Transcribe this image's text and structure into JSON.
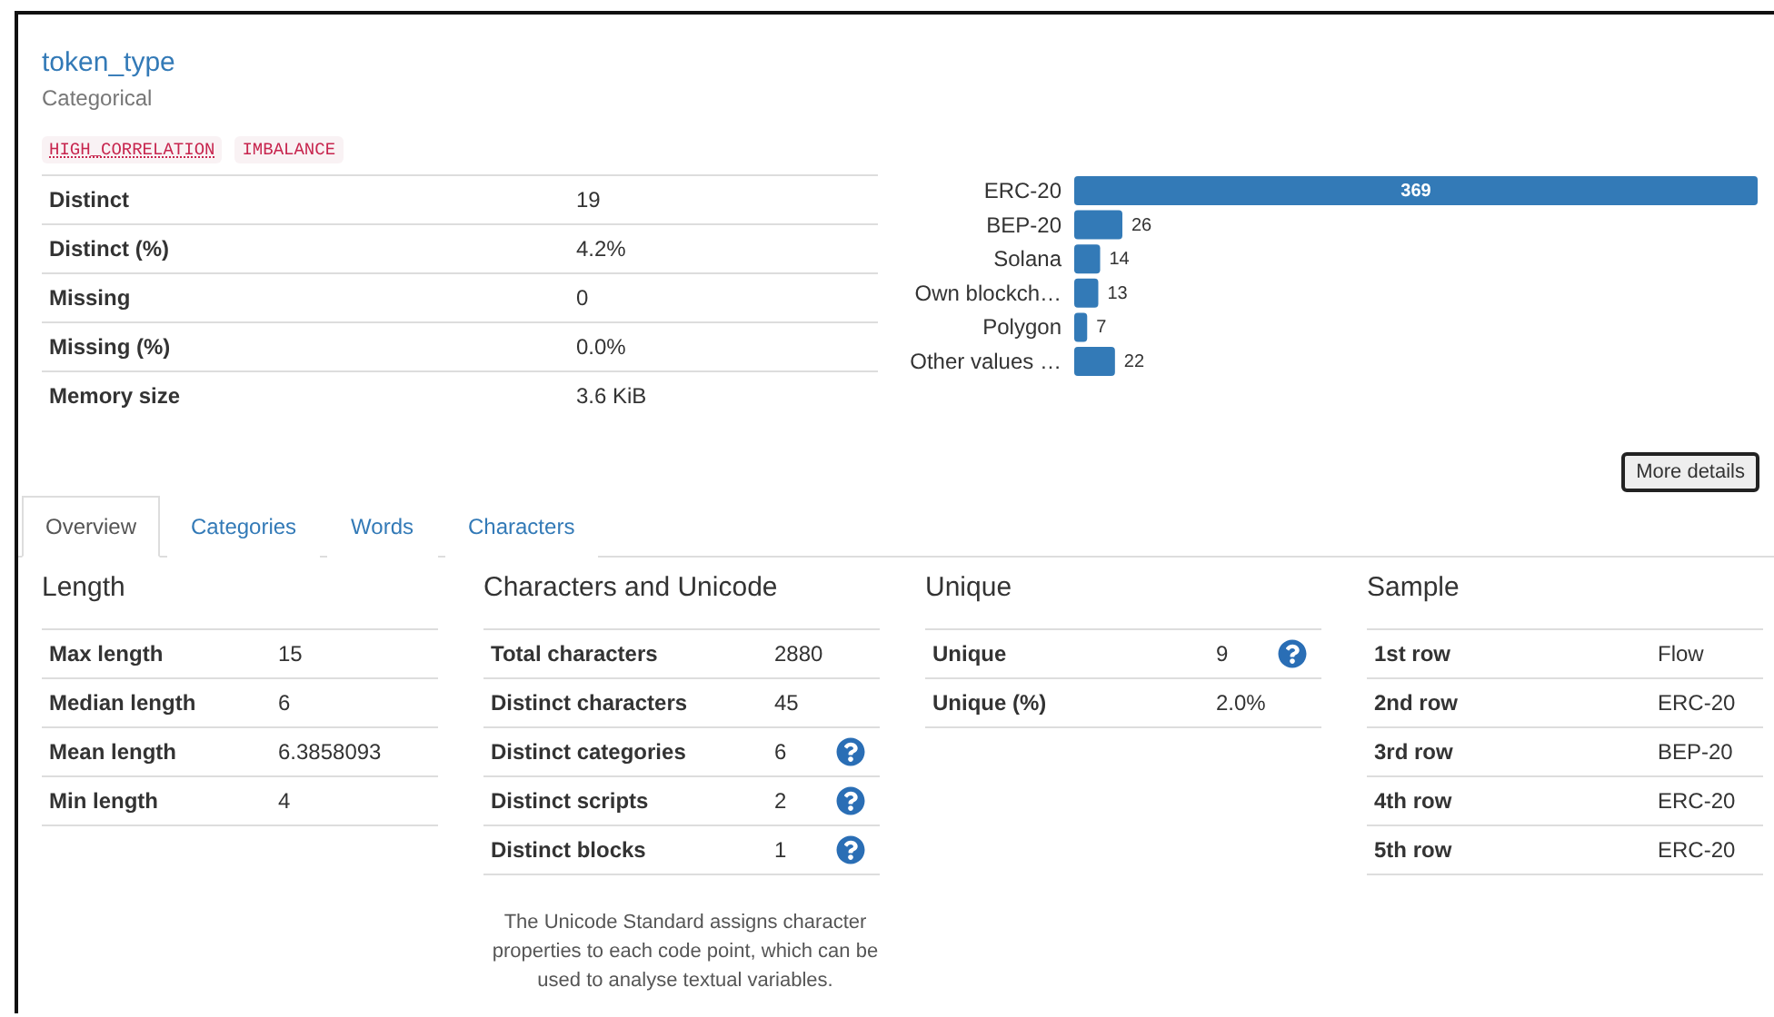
{
  "variable": {
    "name": "token_type",
    "type": "Categorical"
  },
  "alerts": [
    "HIGH_CORRELATION",
    "IMBALANCE"
  ],
  "summary": [
    {
      "label": "Distinct",
      "value": "19"
    },
    {
      "label": "Distinct (%)",
      "value": "4.2%"
    },
    {
      "label": "Missing",
      "value": "0"
    },
    {
      "label": "Missing (%)",
      "value": "0.0%"
    },
    {
      "label": "Memory size",
      "value": "3.6 KiB"
    }
  ],
  "chart_data": {
    "type": "bar",
    "orientation": "horizontal",
    "data_labels": true,
    "categories": [
      "ERC-20",
      "BEP-20",
      "Solana",
      "Own blockch…",
      "Polygon",
      "Other values …"
    ],
    "values": [
      369,
      26,
      14,
      13,
      7,
      22
    ]
  },
  "more_details_button": "More details",
  "tabs": [
    {
      "label": "Overview",
      "selected": true
    },
    {
      "label": "Categories",
      "selected": false
    },
    {
      "label": "Words",
      "selected": false
    },
    {
      "label": "Characters",
      "selected": false
    }
  ],
  "sections": [
    {
      "title": "Length",
      "rows": [
        {
          "label": "Max length",
          "value": "15",
          "help": false
        },
        {
          "label": "Median length",
          "value": "6",
          "help": false
        },
        {
          "label": "Mean length",
          "value": "6.3858093",
          "help": false
        },
        {
          "label": "Min length",
          "value": "4",
          "help": false
        }
      ]
    },
    {
      "title": "Characters and Unicode",
      "rows": [
        {
          "label": "Total characters",
          "value": "2880",
          "help": false
        },
        {
          "label": "Distinct characters",
          "value": "45",
          "help": false
        },
        {
          "label": "Distinct categories",
          "value": "6",
          "help": true
        },
        {
          "label": "Distinct scripts",
          "value": "2",
          "help": true
        },
        {
          "label": "Distinct blocks",
          "value": "1",
          "help": true
        }
      ],
      "note": "The Unicode Standard assigns character properties to each code point, which can be used to analyse textual variables."
    },
    {
      "title": "Unique",
      "rows": [
        {
          "label": "Unique",
          "value": "9",
          "help": true
        },
        {
          "label": "Unique (%)",
          "value": "2.0%",
          "help": false
        }
      ]
    },
    {
      "title": "Sample",
      "rows": [
        {
          "label": "1st row",
          "value": "Flow",
          "help": false
        },
        {
          "label": "2nd row",
          "value": "ERC-20",
          "help": false
        },
        {
          "label": "3rd row",
          "value": "BEP-20",
          "help": false
        },
        {
          "label": "4th row",
          "value": "ERC-20",
          "help": false
        },
        {
          "label": "5th row",
          "value": "ERC-20",
          "help": false
        }
      ]
    }
  ]
}
